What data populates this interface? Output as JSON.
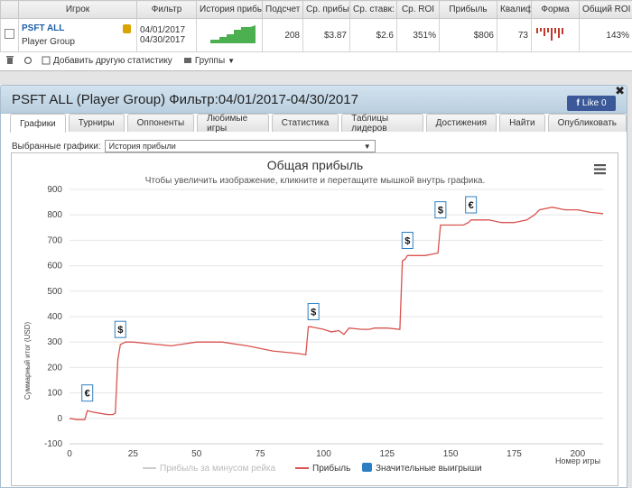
{
  "stats": {
    "headers": [
      "Игрок",
      "Фильтр",
      "История прибы",
      "Подсчет",
      "Ср. прибы",
      "Ср. ставк:",
      "Ср. ROI",
      "Прибыль",
      "Квалиф",
      "Форма",
      "Общий ROI"
    ],
    "player": "PSFT ALL",
    "group": "Player Group",
    "filter_from": "04/01/2017",
    "filter_to": "04/30/2017",
    "count": "208",
    "avg_profit": "$3.87",
    "avg_stake": "$2.6",
    "avg_roi": "351%",
    "profit": "$806",
    "itm": "73",
    "total_roi": "143%"
  },
  "toolbar": {
    "add_stats": "Добавить другую статистику",
    "groups": "Группы"
  },
  "panel": {
    "title": "PSFT ALL (Player Group) Фильтр:04/01/2017-04/30/2017",
    "fb_like": "Like 0",
    "tabs": [
      "Графики",
      "Турниры",
      "Оппоненты",
      "Любимые игры",
      "Статистика",
      "Таблицы лидеров",
      "Достижения",
      "Найти",
      "Опубликовать"
    ],
    "selected_label": "Выбранные графики:",
    "selected_value": "История прибыли"
  },
  "chart_data": {
    "type": "line",
    "title": "Общая прибыль",
    "subtitle": "Чтобы увеличить изображение, кликните и перетащите мышкой внутрь графика.",
    "ylabel": "Суммарный итог (USD)",
    "xlabel": "Номер игры",
    "ylim": [
      -100,
      900
    ],
    "xlim": [
      0,
      210
    ],
    "yticks": [
      -100,
      0,
      100,
      200,
      300,
      400,
      500,
      600,
      700,
      800,
      900
    ],
    "xticks": [
      0,
      25,
      50,
      75,
      100,
      125,
      150,
      175,
      200
    ],
    "legend": [
      "Прибыль за минусом рейка",
      "Прибыль",
      "Значительные выигрыши"
    ],
    "series": [
      {
        "name": "Прибыль",
        "color": "#d9534f",
        "x": [
          0,
          3,
          5,
          6,
          7,
          9,
          12,
          15,
          17,
          18,
          19,
          20,
          22,
          25,
          30,
          40,
          50,
          60,
          70,
          80,
          90,
          93,
          94,
          95,
          100,
          103,
          106,
          108,
          110,
          115,
          118,
          120,
          125,
          130,
          131,
          132,
          133,
          135,
          140,
          145,
          146,
          150,
          155,
          157,
          158,
          160,
          165,
          170,
          175,
          180,
          183,
          185,
          190,
          195,
          200,
          205,
          210
        ],
        "y": [
          0,
          -5,
          -5,
          -5,
          30,
          25,
          20,
          15,
          15,
          20,
          230,
          290,
          300,
          300,
          295,
          285,
          300,
          300,
          285,
          265,
          255,
          250,
          360,
          360,
          350,
          340,
          345,
          330,
          355,
          350,
          350,
          355,
          355,
          350,
          620,
          625,
          640,
          640,
          640,
          650,
          760,
          760,
          760,
          770,
          780,
          780,
          780,
          770,
          770,
          780,
          800,
          820,
          830,
          820,
          820,
          810,
          805
        ]
      },
      {
        "name": "Прибыль за минусом рейка",
        "color": "#cccccc",
        "x": [],
        "y": []
      }
    ],
    "markers": [
      {
        "x": 7,
        "y": 50,
        "label": "€"
      },
      {
        "x": 20,
        "y": 300,
        "label": "$"
      },
      {
        "x": 96,
        "y": 370,
        "label": "$"
      },
      {
        "x": 133,
        "y": 650,
        "label": "$"
      },
      {
        "x": 146,
        "y": 770,
        "label": "$"
      },
      {
        "x": 158,
        "y": 790,
        "label": "€"
      }
    ]
  }
}
